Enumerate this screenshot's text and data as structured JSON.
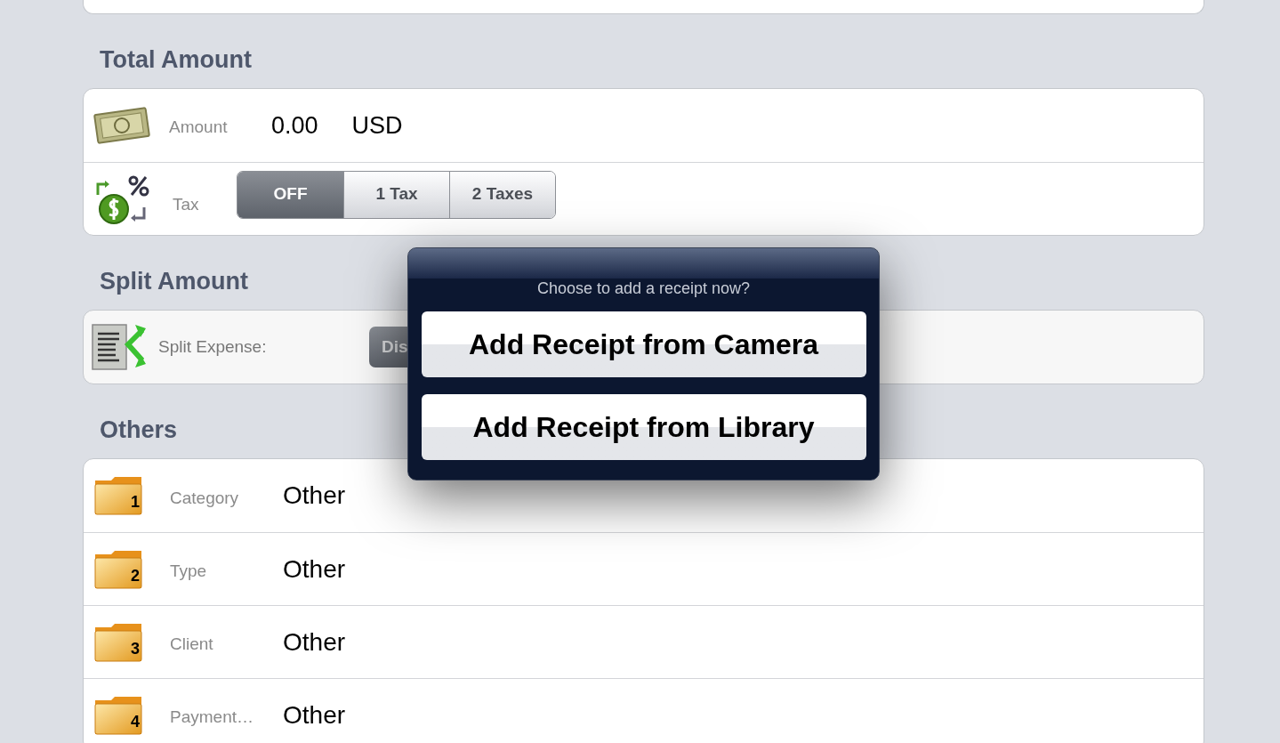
{
  "sections": [
    {
      "title": "Total Amount",
      "rows": [
        {
          "kind": "amount",
          "label": "Amount",
          "value": "0.00",
          "unit": "USD"
        },
        {
          "kind": "tax",
          "label": "Tax",
          "segments": [
            {
              "label": "OFF",
              "selected": true
            },
            {
              "label": "1 Tax",
              "selected": false
            },
            {
              "label": "2 Taxes",
              "selected": false
            }
          ]
        }
      ]
    },
    {
      "title": "Split Amount",
      "rows": [
        {
          "kind": "split",
          "label": "Split Expense:",
          "button": "Dis"
        }
      ]
    },
    {
      "title": "Others",
      "rows": [
        {
          "kind": "folder",
          "badge": "1",
          "label": "Category",
          "value": "Other"
        },
        {
          "kind": "folder",
          "badge": "2",
          "label": "Type",
          "value": "Other"
        },
        {
          "kind": "folder",
          "badge": "3",
          "label": "Client",
          "value": "Other"
        },
        {
          "kind": "folder",
          "badge": "4",
          "label": "Payment…",
          "value": "Other"
        }
      ]
    }
  ],
  "popover": {
    "title": "Choose to add a receipt now?",
    "buttons": [
      "Add Receipt from Camera",
      "Add Receipt from Library"
    ]
  }
}
